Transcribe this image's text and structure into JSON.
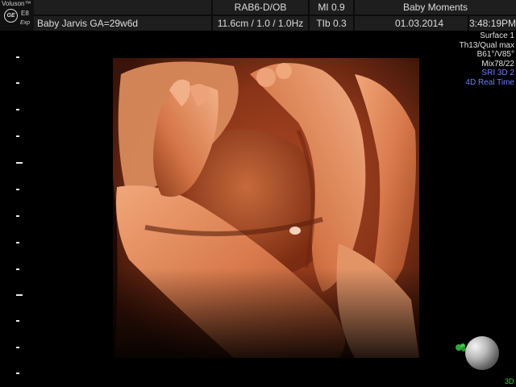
{
  "header": {
    "brand": "Voluson™",
    "logo_text": "GE",
    "model": "E8",
    "model_sub": "Exp",
    "probe": "RAB6-D/OB",
    "mi": "MI  0.9",
    "app": "Baby Moments",
    "patient": "Baby Jarvis  GA=29w6d",
    "settings": "11.6cm / 1.0 / 1.0Hz",
    "tib": "TIb  0.3",
    "date": "01.03.2014",
    "time": "3:48:19PM"
  },
  "params": {
    "line1": "Surface 1",
    "line2": "Th13/Qual max",
    "line3": "B61°/V85°",
    "line4": "Mix78/22",
    "line5": "SRI 3D 2",
    "line6": "4D Real Time"
  },
  "footer": {
    "mode": "3D"
  },
  "colors": {
    "header_bg": "#1e1e1e",
    "accent_blue": "#6f7dff",
    "render_tone": "#c8643c",
    "marker_green": "#3fc84a"
  },
  "icons": {
    "logo": "ge-logo-icon",
    "orientation": "orientation-marker-icon",
    "probe": "probe-orientation-ball-icon"
  }
}
